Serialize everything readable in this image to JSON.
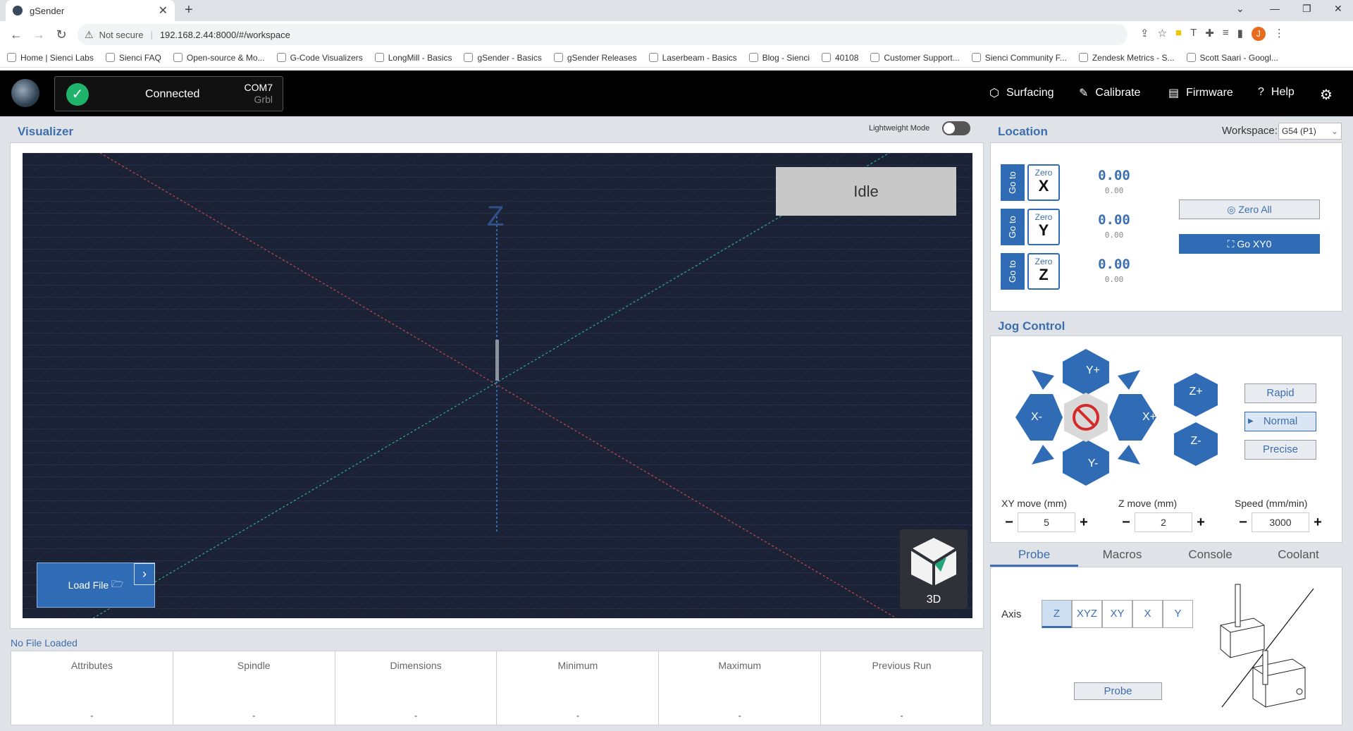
{
  "browser": {
    "tab_title": "gSender",
    "address": {
      "security": "Not secure",
      "url": "192.168.2.44:8000/#/workspace"
    },
    "bookmarks": [
      "Home | Sienci Labs",
      "Sienci FAQ",
      "Open-source & Mo...",
      "G-Code Visualizers",
      "LongMill - Basics",
      "gSender - Basics",
      "gSender Releases",
      "Laserbeam - Basics",
      "Blog - Sienci",
      "40108",
      "Customer Support...",
      "Sienci Community F...",
      "Zendesk Metrics - S...",
      "Scott Saari - Googl..."
    ],
    "avatar_letter": "J"
  },
  "header": {
    "connection": {
      "status": "Connected",
      "port": "COM7",
      "firmware": "Grbl"
    },
    "menu": [
      {
        "icon": "surfacing-icon",
        "label": "Surfacing"
      },
      {
        "icon": "calibrate-icon",
        "label": "Calibrate"
      },
      {
        "icon": "firmware-icon",
        "label": "Firmware"
      },
      {
        "icon": "help-icon",
        "label": "Help"
      }
    ]
  },
  "visualizer": {
    "title": "Visualizer",
    "lightweight_label": "Lightweight Mode",
    "state": "Idle",
    "axis_label": "Z",
    "load_file": "Load File",
    "cube_label": "3D"
  },
  "file": {
    "status": "No File Loaded",
    "stats": [
      {
        "label": "Attributes",
        "value": "-"
      },
      {
        "label": "Spindle",
        "value": "-"
      },
      {
        "label": "Dimensions",
        "value": "-"
      },
      {
        "label": "Minimum",
        "value": "-"
      },
      {
        "label": "Maximum",
        "value": "-"
      },
      {
        "label": "Previous Run",
        "value": "-"
      }
    ]
  },
  "location": {
    "title": "Location",
    "workspace_label": "Workspace:",
    "workspace_value": "G54 (P1)",
    "goto_label": "Go to",
    "zero_label": "Zero",
    "axes": [
      {
        "axis": "X",
        "work": "0.00",
        "machine": "0.00"
      },
      {
        "axis": "Y",
        "work": "0.00",
        "machine": "0.00"
      },
      {
        "axis": "Z",
        "work": "0.00",
        "machine": "0.00"
      }
    ],
    "zero_all": "Zero All",
    "go_xy0": "Go  XY0"
  },
  "jog": {
    "title": "Jog Control",
    "buttons": {
      "y_plus": "Y+",
      "y_minus": "Y-",
      "x_plus": "X+",
      "x_minus": "X-",
      "z_plus": "Z+",
      "z_minus": "Z-"
    },
    "modes": [
      "Rapid",
      "Normal",
      "Precise"
    ],
    "selected_mode": "Normal",
    "xy_label": "XY move (mm)",
    "xy_value": "5",
    "z_label": "Z move (mm)",
    "z_value": "2",
    "speed_label": "Speed (mm/min)",
    "speed_value": "3000"
  },
  "tabs": [
    "Probe",
    "Macros",
    "Console",
    "Coolant"
  ],
  "probe": {
    "axis_label": "Axis",
    "axes": [
      "Z",
      "XYZ",
      "XY",
      "X",
      "Y"
    ],
    "selected": "Z",
    "button": "Probe"
  }
}
